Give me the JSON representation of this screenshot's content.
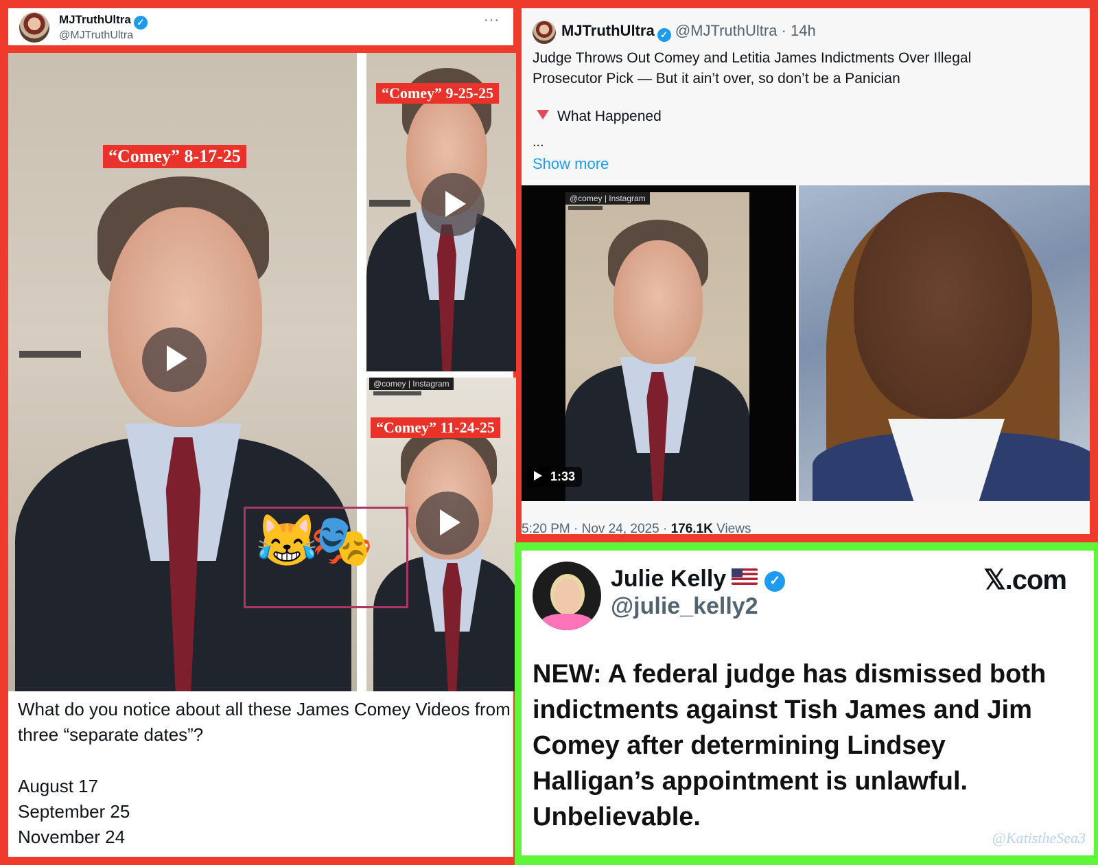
{
  "left_post": {
    "author_name": "MJTruthUltra",
    "author_handle": "@MJTruthUltra",
    "more_label": "···",
    "tags": {
      "aug": "“Comey” 8-17-25",
      "sep": "“Comey” 9-25-25",
      "nov": "“Comey” 11-24-25"
    },
    "instagram_tag": "@comey | Instagram",
    "emojis": "😹🎭",
    "question": "What do you notice about all these James Comey Videos from three “separate dates”?",
    "dates": [
      "August 17",
      "September 25",
      "November 24"
    ]
  },
  "right_top_post": {
    "author_name": "MJTruthUltra",
    "author_handle": "@MJTruthUltra",
    "time": "· 14h",
    "title": "Judge Throws Out Comey and Letitia James Indictments Over Illegal Prosecutor Pick — But it ain’t over, so don’t be a Panician",
    "subheading": "What Happened",
    "ellipsis": "...",
    "show_more": "Show more",
    "instagram_tag": "@comey | Instagram",
    "video_duration": "1:33",
    "timestamp": "5:20 PM · Nov 24, 2025 ·",
    "views_count": "176.1K",
    "views_label": "Views"
  },
  "right_bottom_post": {
    "author_name": "Julie Kelly",
    "author_handle": "@julie_kelly2",
    "brand": "𝕏.com",
    "text": "NEW: A federal judge has dismissed both indictments against Tish James and Jim Comey after determining Lindsey Halligan’s appointment is unlawful. Unbelievable.",
    "watermark": "@KatistheSea3"
  },
  "colors": {
    "left_border": "#ef3b2c",
    "right_top_border": "#ef3b2c",
    "right_bottom_border": "#5ff53a",
    "link_blue": "#1d9bf0",
    "tag_red": "#e8322a",
    "emoji_box": "#a8385f"
  },
  "icons": [
    "verified-icon",
    "more-icon",
    "play-icon",
    "triangle-down-icon",
    "us-flag-icon",
    "x-logo"
  ]
}
